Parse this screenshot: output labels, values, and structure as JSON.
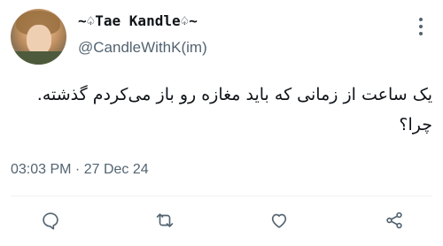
{
  "author": {
    "display_name": "~♤Tae Kandle♤~",
    "handle": "@CandleWithK(im)"
  },
  "tweet": {
    "line1": "یک ساعت از زمانی که باید مغازه رو باز می‌کردم گذشته.",
    "line2": "چرا؟",
    "timestamp": "03:03 PM · 27 Dec 24"
  },
  "actions": {
    "reply_icon": "reply-icon",
    "retweet_icon": "retweet-icon",
    "like_icon": "heart-icon",
    "share_icon": "share-icon"
  },
  "colors": {
    "text": "#0f1419",
    "secondary": "#536471",
    "divider": "#eff3f4"
  }
}
